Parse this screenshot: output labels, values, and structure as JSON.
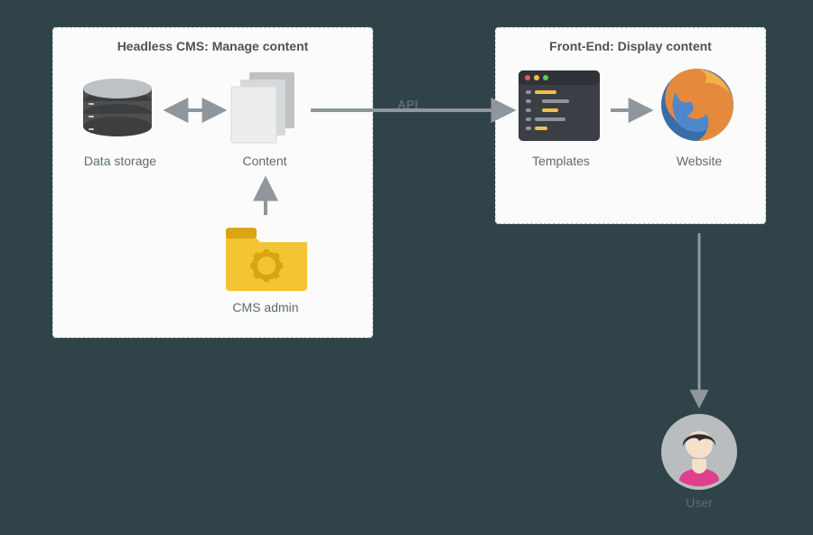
{
  "panels": {
    "left_title": "Headless CMS: Manage content",
    "right_title": "Front-End: Display content"
  },
  "nodes": {
    "data_storage": "Data storage",
    "content": "Content",
    "cms_admin": "CMS admin",
    "templates": "Templates",
    "website": "Website",
    "user": "User"
  },
  "edges": {
    "api": "API"
  },
  "diagram": {
    "description": "Headless CMS architecture: data storage syncs bidirectionally with content; a CMS admin feeds content; content is exposed via an API to front-end templates which render a website delivered to the user.",
    "flows": [
      {
        "from": "data_storage",
        "to": "content",
        "direction": "bidirectional"
      },
      {
        "from": "cms_admin",
        "to": "content",
        "direction": "forward"
      },
      {
        "from": "content",
        "to": "templates",
        "direction": "forward",
        "label": "API"
      },
      {
        "from": "templates",
        "to": "website",
        "direction": "forward"
      },
      {
        "from": "website",
        "to": "user",
        "direction": "forward"
      }
    ]
  }
}
